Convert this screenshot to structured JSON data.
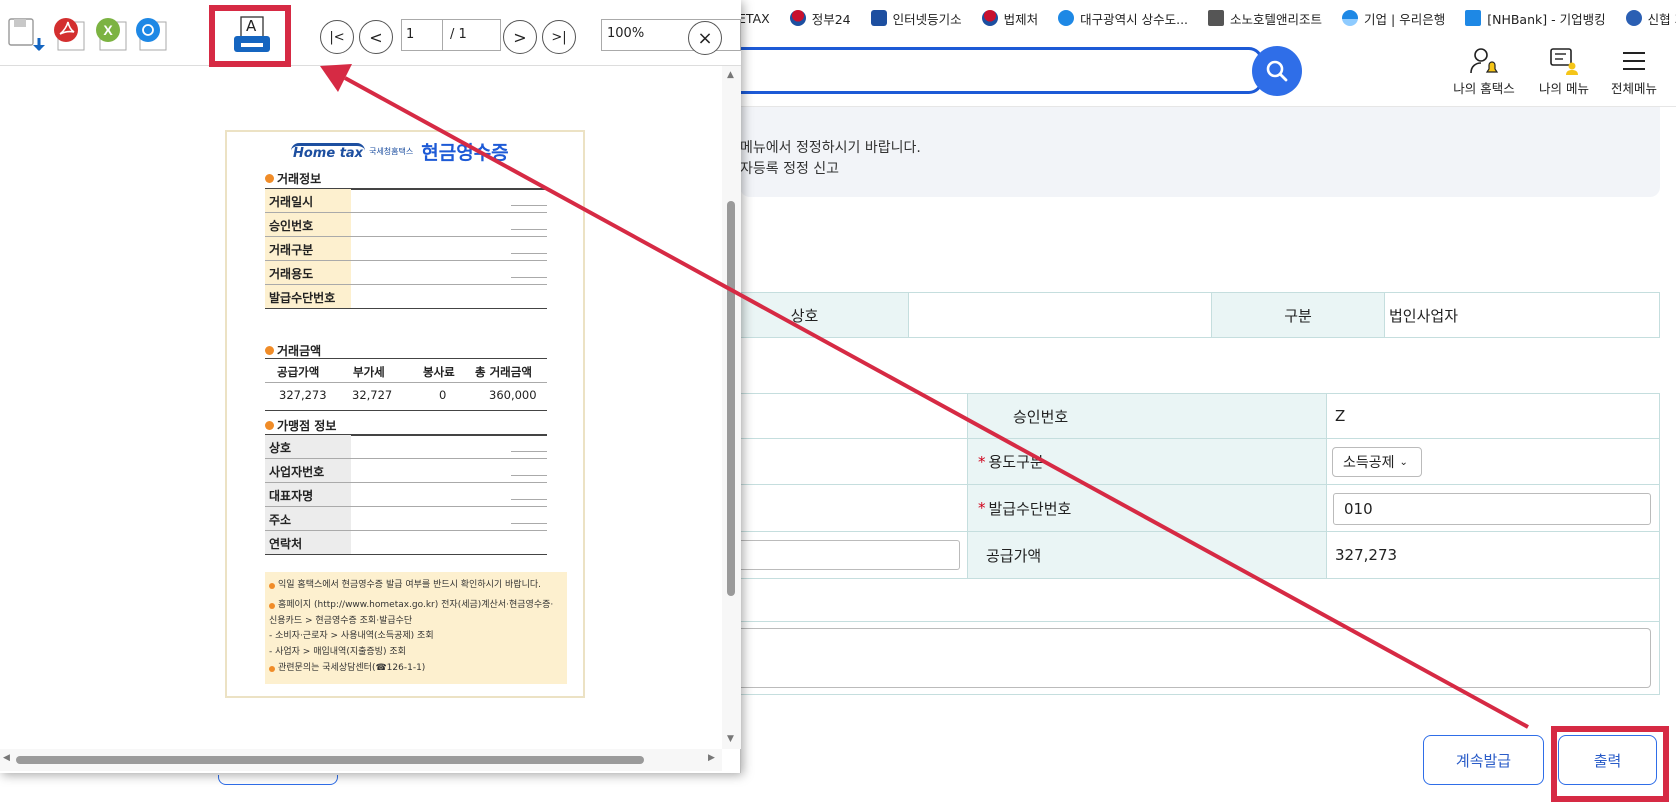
{
  "bookmarks": [
    {
      "label": "ETAX",
      "color": "#ffffff"
    },
    {
      "label": "정부24",
      "color": "#c8102e"
    },
    {
      "label": "인터넷등기소",
      "color": "#1d4fa0"
    },
    {
      "label": "법제처",
      "color": "#c8102e"
    },
    {
      "label": "대구광역시 상수도...",
      "color": "#1e88e5"
    },
    {
      "label": "소노호텔앤리조트",
      "color": "#555555"
    },
    {
      "label": "기업 | 우리은행",
      "color": "#1e88e5"
    },
    {
      "label": "[NHBank] - 기업뱅킹",
      "color": "#1e88e5"
    },
    {
      "label": "신협 기업",
      "color": "#2b5fb3"
    }
  ],
  "header": {
    "my_hometax": "나의 홈택스",
    "my_menu": "나의 메뉴",
    "all_menu": "전체메뉴"
  },
  "notice": {
    "line1": "메뉴에서 정정하시기 바랍니다.",
    "line2": "자등록 정정 신고"
  },
  "info_table": {
    "company_label": "상호",
    "company_value": "",
    "type_label": "구분",
    "type_value": "법인사업자"
  },
  "detail_table": {
    "approval_label": "승인번호",
    "approval_value": "Z",
    "usage_label": "용도구분",
    "usage_value": "소득공제",
    "means_label": "발급수단번호",
    "means_value": "010",
    "supply_label": "공급가액",
    "supply_value": "327,273",
    "required_mark": "*"
  },
  "buttons": {
    "continue": "계속발급",
    "print": "출력"
  },
  "viewer": {
    "page_current": "1",
    "page_total": "/ 1",
    "zoom": "100%",
    "print_icon_letter": "A",
    "nav_first": "|<",
    "nav_prev": "<",
    "nav_next": ">",
    "nav_last": ">|",
    "close": "×"
  },
  "receipt": {
    "logo_text": "Home tax",
    "logo_sub": "국세청홈택스",
    "title": "현금영수증",
    "sec_transaction": "거래정보",
    "rows_transaction": [
      "거래일시",
      "승인번호",
      "거래구분",
      "거래용도",
      "발급수단번호"
    ],
    "sec_amount": "거래금액",
    "amount_headers": [
      "공급가액",
      "부가세",
      "봉사료",
      "총 거래금액"
    ],
    "amount_values": [
      "327,273",
      "32,727",
      "0",
      "360,000"
    ],
    "sec_merchant": "가맹점 정보",
    "rows_merchant": [
      "상호",
      "사업자번호",
      "대표자명",
      "주소",
      "연락처"
    ],
    "notes": [
      "익일 홈택스에서 현금영수증 발급 여부를 반드시 확인하시기 바랍니다.",
      "홈페이지 (http://www.hometax.go.kr) 전자(세금)계산서·현금영수증·",
      "신용카드 > 현금영수증 조회·발급수단",
      "- 소비자·근로자 > 사용내역(소득공제) 조회",
      "- 사업자 > 매입내역(지출증빙) 조회",
      "관련문의는 국세상담센터(☎126-1-1)"
    ]
  },
  "colors": {
    "annotation": "#d62a44",
    "accent": "#2f6ee8"
  }
}
